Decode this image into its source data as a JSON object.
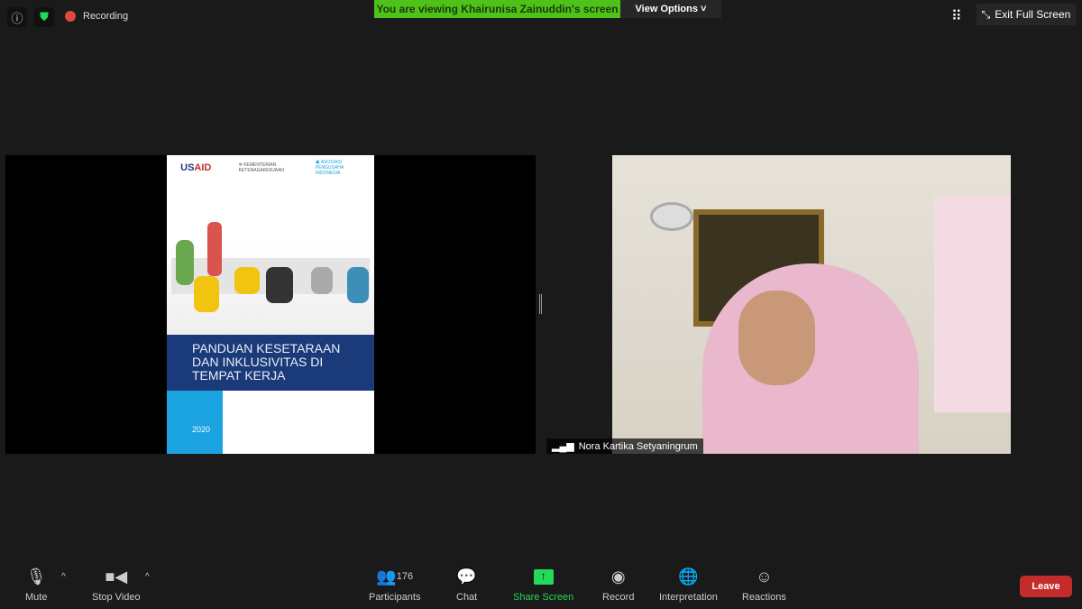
{
  "topbar": {
    "recording_label": "Recording",
    "banner": "You are viewing Khairunisa Zainuddin's screen",
    "view_options": "View Options",
    "exit_fullscreen": "Exit Full Screen"
  },
  "shared_doc": {
    "logos": [
      "USAID",
      "KEMENTERIAN KETENAGAKERJAAN REPUBLIK INDONESIA",
      "ASOSIASI PENGUSAHA INDONESIA"
    ],
    "title": "PANDUAN KESETARAAN DAN INKLUSIVITAS DI TEMPAT KERJA",
    "year": "2020",
    "colors": {
      "band": "#1b3a7a",
      "accent": "#1aa3e0"
    }
  },
  "video": {
    "participant_name": "Nora Kartika Setyaningrum"
  },
  "toolbar": {
    "mute": "Mute",
    "stop_video": "Stop Video",
    "participants": "Participants",
    "participant_count": "176",
    "chat": "Chat",
    "share_screen": "Share Screen",
    "record": "Record",
    "interpretation": "Interpretation",
    "reactions": "Reactions",
    "leave": "Leave"
  },
  "colors": {
    "green": "#23d959",
    "leave": "#c42c2c"
  }
}
